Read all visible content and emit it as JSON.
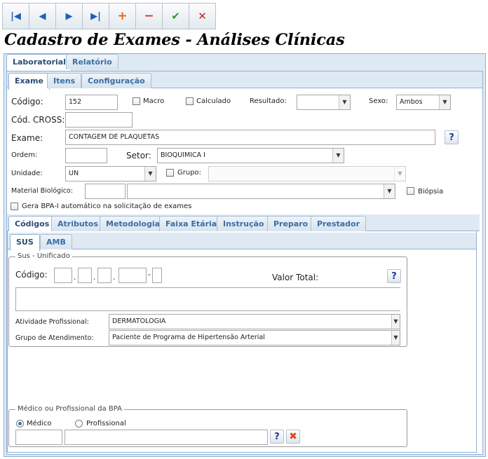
{
  "toolbar": {
    "first": "|◀",
    "prev": "◀",
    "next": "▶",
    "last": "▶|",
    "add": "+",
    "remove": "−",
    "confirm": "✔",
    "cancel": "✕"
  },
  "page_title": "Cadastro de Exames - Análises Clínicas",
  "top_tabs": [
    "Laboratorial",
    "Relatório"
  ],
  "sub_tabs": [
    "Exame",
    "Itens",
    "Configuração"
  ],
  "form": {
    "codigo_label": "Código:",
    "codigo_value": "152",
    "macro_label": "Macro",
    "calculado_label": "Calculado",
    "resultado_label": "Resultado:",
    "resultado_value": "",
    "sexo_label": "Sexo:",
    "sexo_value": "Ambos",
    "cod_cross_label": "Cód. CROSS:",
    "cod_cross_value": "",
    "exame_label": "Exame:",
    "exame_value": "CONTAGEM DE PLAQUETAS",
    "ordem_label": "Ordem:",
    "ordem_value": "",
    "setor_label": "Setor:",
    "setor_value": "BIOQUIMICA I",
    "unidade_label": "Unidade:",
    "unidade_value": "UN",
    "grupo_label": "Grupo:",
    "grupo_value": "",
    "material_label": "Material Biológico:",
    "material_code": "",
    "material_value": "",
    "biopsia_label": "Biópsia",
    "bpa_label": "Gera BPA-I automático na solicitação de exames",
    "help": "?"
  },
  "detail_tabs": [
    "Códigos",
    "Atributos",
    "Metodologia",
    "Faixa Etária",
    "Instrução",
    "Preparo",
    "Prestador"
  ],
  "code_tabs": [
    "SUS",
    "AMB"
  ],
  "sus": {
    "group_title": "Sus - Unificado",
    "codigo_label": "Código:",
    "sep_dot": ".",
    "sep_dash": "-",
    "valor_total_label": "Valor Total:",
    "description": "",
    "atividade_label": "Atividade Profissional:",
    "atividade_value": "DERMATOLOGIA",
    "grupo_atend_label": "Grupo de Atendimento:",
    "grupo_atend_value": "Paciente de Programa de Hipertensão Arterial",
    "help": "?"
  },
  "bpa": {
    "group_title": "Médico ou Profissional da BPA",
    "medico_label": "Médico",
    "profissional_label": "Profissional",
    "selected": "Médico",
    "code_value": "",
    "name_value": "",
    "help": "?",
    "clear_icon": "✖"
  },
  "colors": {
    "tab_text": "#3a6ea5",
    "panel_bg": "#dfe9f3",
    "border": "#8fb1d6"
  }
}
